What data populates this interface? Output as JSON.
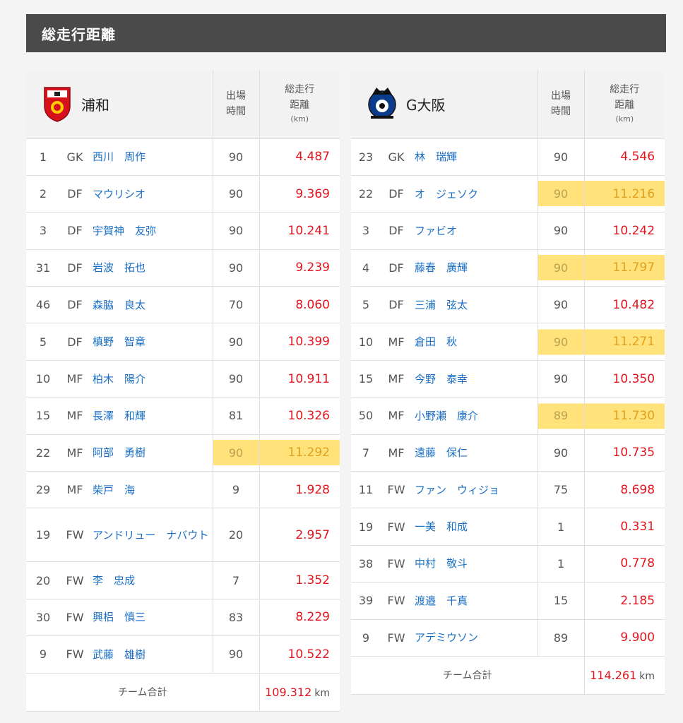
{
  "page_title": "総走行距離",
  "header_labels": {
    "time": [
      "出場",
      "時間"
    ],
    "distance": [
      "総走行",
      "距離"
    ],
    "unit": "(km)"
  },
  "teams": [
    {
      "name": "浦和",
      "emblem": "urawa-emblem-icon",
      "players": [
        {
          "no": "1",
          "pos": "GK",
          "name": "西川　周作",
          "time": "90",
          "dist": "4.487",
          "hl": false
        },
        {
          "no": "2",
          "pos": "DF",
          "name": "マウリシオ",
          "time": "90",
          "dist": "9.369",
          "hl": false
        },
        {
          "no": "3",
          "pos": "DF",
          "name": "宇賀神　友弥",
          "time": "90",
          "dist": "10.241",
          "hl": false
        },
        {
          "no": "31",
          "pos": "DF",
          "name": "岩波　拓也",
          "time": "90",
          "dist": "9.239",
          "hl": false
        },
        {
          "no": "46",
          "pos": "DF",
          "name": "森脇　良太",
          "time": "70",
          "dist": "8.060",
          "hl": false
        },
        {
          "no": "5",
          "pos": "DF",
          "name": "槙野　智章",
          "time": "90",
          "dist": "10.399",
          "hl": false
        },
        {
          "no": "10",
          "pos": "MF",
          "name": "柏木　陽介",
          "time": "90",
          "dist": "10.911",
          "hl": false
        },
        {
          "no": "15",
          "pos": "MF",
          "name": "長澤　和輝",
          "time": "81",
          "dist": "10.326",
          "hl": false
        },
        {
          "no": "22",
          "pos": "MF",
          "name": "阿部　勇樹",
          "time": "90",
          "dist": "11.292",
          "hl": true
        },
        {
          "no": "29",
          "pos": "MF",
          "name": "柴戸　海",
          "time": "9",
          "dist": "1.928",
          "hl": false
        },
        {
          "no": "19",
          "pos": "FW",
          "name": "アンドリュー　ナバウト",
          "time": "20",
          "dist": "2.957",
          "hl": false,
          "tall": true
        },
        {
          "no": "20",
          "pos": "FW",
          "name": "李　忠成",
          "time": "7",
          "dist": "1.352",
          "hl": false
        },
        {
          "no": "30",
          "pos": "FW",
          "name": "興梠　慎三",
          "time": "83",
          "dist": "8.229",
          "hl": false
        },
        {
          "no": "9",
          "pos": "FW",
          "name": "武藤　雄樹",
          "time": "90",
          "dist": "10.522",
          "hl": false
        }
      ],
      "total_label": "チーム合計",
      "total_value": "109.312",
      "total_unit": "km"
    },
    {
      "name": "G大阪",
      "emblem": "gamba-emblem-icon",
      "players": [
        {
          "no": "23",
          "pos": "GK",
          "name": "林　瑞輝",
          "time": "90",
          "dist": "4.546",
          "hl": false
        },
        {
          "no": "22",
          "pos": "DF",
          "name": "オ　ジェソク",
          "time": "90",
          "dist": "11.216",
          "hl": true
        },
        {
          "no": "3",
          "pos": "DF",
          "name": "ファビオ",
          "time": "90",
          "dist": "10.242",
          "hl": false
        },
        {
          "no": "4",
          "pos": "DF",
          "name": "藤春　廣輝",
          "time": "90",
          "dist": "11.797",
          "hl": true
        },
        {
          "no": "5",
          "pos": "DF",
          "name": "三浦　弦太",
          "time": "90",
          "dist": "10.482",
          "hl": false
        },
        {
          "no": "10",
          "pos": "MF",
          "name": "倉田　秋",
          "time": "90",
          "dist": "11.271",
          "hl": true
        },
        {
          "no": "15",
          "pos": "MF",
          "name": "今野　泰幸",
          "time": "90",
          "dist": "10.350",
          "hl": false
        },
        {
          "no": "50",
          "pos": "MF",
          "name": "小野瀬　康介",
          "time": "89",
          "dist": "11.730",
          "hl": true
        },
        {
          "no": "7",
          "pos": "MF",
          "name": "遠藤　保仁",
          "time": "90",
          "dist": "10.735",
          "hl": false
        },
        {
          "no": "11",
          "pos": "FW",
          "name": "ファン　ウィジョ",
          "time": "75",
          "dist": "8.698",
          "hl": false
        },
        {
          "no": "19",
          "pos": "FW",
          "name": "一美　和成",
          "time": "1",
          "dist": "0.331",
          "hl": false
        },
        {
          "no": "38",
          "pos": "FW",
          "name": "中村　敬斗",
          "time": "1",
          "dist": "0.778",
          "hl": false
        },
        {
          "no": "39",
          "pos": "FW",
          "name": "渡邉　千真",
          "time": "15",
          "dist": "2.185",
          "hl": false
        },
        {
          "no": "9",
          "pos": "FW",
          "name": "アデミウソン",
          "time": "89",
          "dist": "9.900",
          "hl": false
        }
      ],
      "total_label": "チーム合計",
      "total_value": "114.261",
      "total_unit": "km"
    }
  ],
  "colors": {
    "title_bg": "#4a4a4a",
    "player_name": "#1a6fc4",
    "distance": "#e3141d",
    "highlight": "#ffe37a"
  }
}
